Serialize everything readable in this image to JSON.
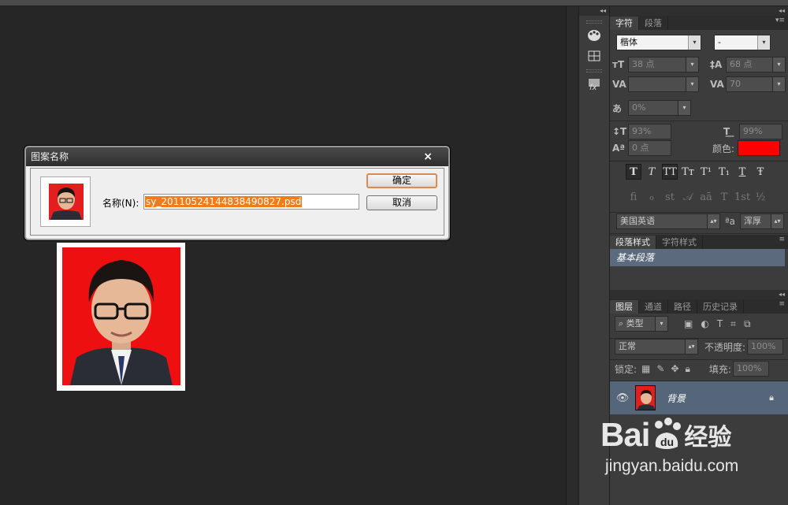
{
  "character_panel": {
    "tabs": [
      "字符",
      "段落"
    ],
    "font_family": "楷体",
    "font_style": "-",
    "font_size": "38 点",
    "leading": "68 点",
    "kerning": "",
    "tracking": "70",
    "scale_ratio": "0%",
    "vertical_scale": "93%",
    "horizontal_scale": "99%",
    "baseline_shift": "0 点",
    "color_label": "颜色:",
    "color_value": "#ff0000",
    "style_buttons": [
      "T",
      "T",
      "TT",
      "Tт",
      "T¹",
      "T₁",
      "T",
      "Ŧ"
    ],
    "opentype_buttons": [
      "ﬁ",
      "ℴ",
      "st",
      "𝒜",
      "aā",
      "T",
      "1st",
      "½"
    ],
    "language": "美国英语",
    "aa_icon": "ªa",
    "antialias": "浑厚"
  },
  "paragraph_styles_panel": {
    "tabs": [
      "段落样式",
      "字符样式"
    ],
    "items": [
      "基本段落"
    ]
  },
  "layers_panel": {
    "tabs": [
      "图层",
      "通道",
      "路径",
      "历史记录"
    ],
    "filter_kind": "类型",
    "blend_mode": "正常",
    "opacity_label": "不透明度:",
    "opacity_value": "100%",
    "lock_label": "锁定:",
    "fill_label": "填充:",
    "fill_value": "100%",
    "layers": [
      {
        "name": "背景",
        "visible": true,
        "locked": true
      }
    ]
  },
  "dialog": {
    "title": "图案名称",
    "close": "×",
    "name_label": "名称(N):",
    "name_value": "sy_20110524144838490827.psd",
    "ok_label": "确定",
    "cancel_label": "取消"
  },
  "watermark": {
    "brand": "Bai",
    "brand_suffix": "经验",
    "url": "jingyan.baidu.com"
  }
}
